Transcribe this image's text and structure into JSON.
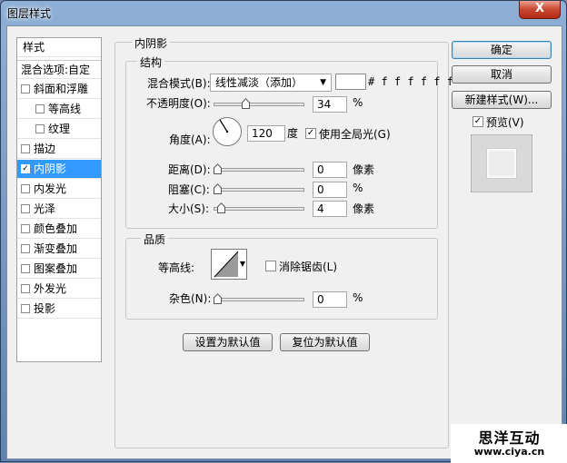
{
  "window": {
    "title": "图层样式",
    "close_glyph": "X"
  },
  "style_list": {
    "header": "样式",
    "blend_options": "混合选项:自定",
    "items": [
      {
        "label": "斜面和浮雕",
        "checked": false
      },
      {
        "label": "等高线",
        "checked": false
      },
      {
        "label": "纹理",
        "checked": false
      },
      {
        "label": "描边",
        "checked": false
      },
      {
        "label": "内阴影",
        "checked": true
      },
      {
        "label": "内发光",
        "checked": false
      },
      {
        "label": "光泽",
        "checked": false
      },
      {
        "label": "颜色叠加",
        "checked": false
      },
      {
        "label": "渐变叠加",
        "checked": false
      },
      {
        "label": "图案叠加",
        "checked": false
      },
      {
        "label": "外发光",
        "checked": false
      },
      {
        "label": "投影",
        "checked": false
      }
    ]
  },
  "inner_shadow": {
    "title": "内阴影",
    "structure": {
      "title": "结构",
      "blend_mode_label": "混合模式(B):",
      "blend_mode_value": "线性减淡（添加）",
      "color_hex": "#ffffff",
      "color_text": "# f f f f f f",
      "opacity_label": "不透明度(O):",
      "opacity_value": "34",
      "opacity_unit": "%",
      "angle_label": "角度(A):",
      "angle_value": "120",
      "angle_unit": "度",
      "global_light_label": "使用全局光(G)",
      "global_light_checked": true,
      "distance_label": "距离(D):",
      "distance_value": "0",
      "distance_unit": "像素",
      "choke_label": "阻塞(C):",
      "choke_value": "0",
      "choke_unit": "%",
      "size_label": "大小(S):",
      "size_value": "4",
      "size_unit": "像素"
    },
    "quality": {
      "title": "品质",
      "contour_label": "等高线:",
      "antialias_label": "消除锯齿(L)",
      "antialias_checked": false,
      "noise_label": "杂色(N):",
      "noise_value": "0",
      "noise_unit": "%"
    },
    "set_default": "设置为默认值",
    "reset_default": "复位为默认值"
  },
  "buttons": {
    "ok": "确定",
    "cancel": "取消",
    "new_style": "新建样式(W)...",
    "preview_label": "预览(V)",
    "preview_checked": true
  },
  "watermark": {
    "brand": "思洋互动",
    "url": "www.ciya.cn"
  },
  "sliders": {
    "opacity": 0.34,
    "distance": 0.0,
    "choke": 0.0,
    "size": 0.04,
    "noise": 0.0
  }
}
